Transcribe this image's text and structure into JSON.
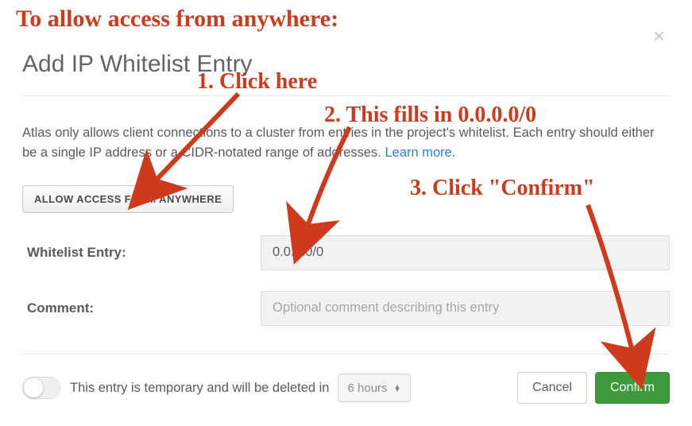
{
  "modal": {
    "title": "Add IP Whitelist Entry",
    "description_part1": "Atlas only allows client connections to a cluster from entries in the project's whitelist. Each entry should either be a single IP address or a CIDR-notated range of addresses. ",
    "learn_more": "Learn more",
    "description_part2": ".",
    "allow_button": "ALLOW ACCESS FROM ANYWHERE",
    "whitelist_label": "Whitelist Entry:",
    "whitelist_value": "0.0.0.0/0",
    "comment_label": "Comment:",
    "comment_placeholder": "Optional comment describing this entry",
    "temp_text": "This entry is temporary and will be deleted in",
    "duration_value": "6 hours",
    "cancel": "Cancel",
    "confirm": "Confirm"
  },
  "annotations": {
    "heading": "To allow access from anywhere:",
    "step1": "1. Click here",
    "step2": "2. This fills in 0.0.0.0/0",
    "step3": "3. Click \"Confirm\""
  }
}
